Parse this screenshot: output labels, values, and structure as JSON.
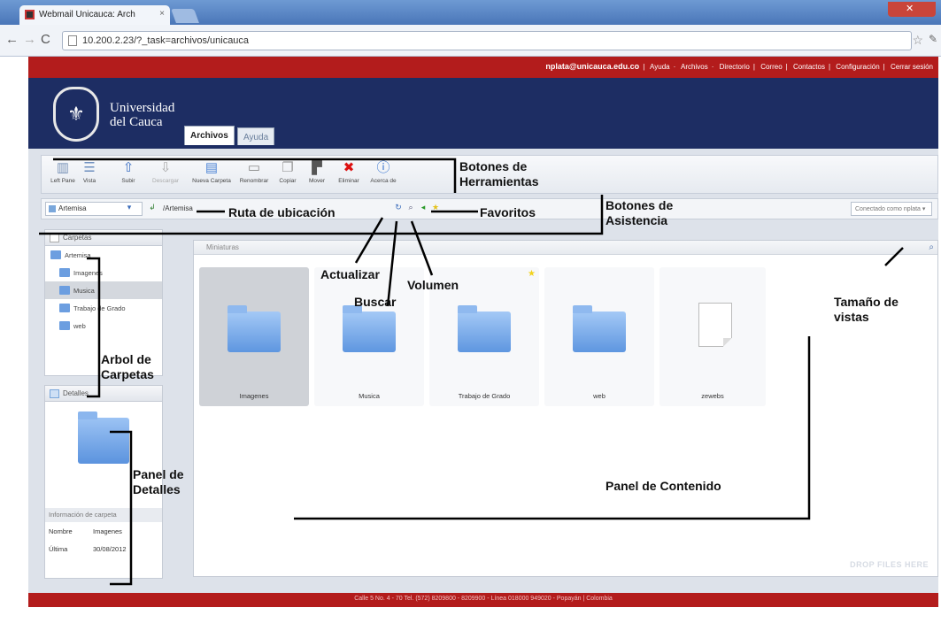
{
  "browser": {
    "tab_title": "Webmail Unicauca: Arch",
    "tab_close": "×",
    "url": "10.200.2.23/?_task=archivos/unicauca",
    "back_icon": "arrow-left",
    "forward_icon": "arrow-right",
    "reload_icon": "reload",
    "window_close": "✕"
  },
  "topbar": {
    "user_email": "nplata@unicauca.edu.co",
    "links": [
      "Ayuda",
      "Archivos",
      "Directorio",
      "Correo",
      "Contactos",
      "Configuración",
      "Cerrar sesión"
    ]
  },
  "header": {
    "university_line1": "Universidad",
    "university_line2": "del Cauca",
    "tabs": [
      "Archivos",
      "Ayuda"
    ]
  },
  "toolbar": {
    "buttons": [
      {
        "label": "Left Pane",
        "icon": "layout-icon"
      },
      {
        "label": "Vista",
        "icon": "view-icon"
      },
      {
        "label": "Subir",
        "icon": "upload-icon"
      },
      {
        "label": "Descargar",
        "icon": "download-icon"
      },
      {
        "label": "Nueva Carpeta",
        "icon": "new-folder-icon"
      },
      {
        "label": "Renombrar",
        "icon": "rename-icon"
      },
      {
        "label": "Copiar",
        "icon": "copy-icon"
      },
      {
        "label": "Mover",
        "icon": "move-icon"
      },
      {
        "label": "Eliminar",
        "icon": "delete-icon"
      },
      {
        "label": "Acerca de",
        "icon": "info-icon"
      }
    ]
  },
  "location": {
    "drive": "Artemisa",
    "path": "/Artemisa",
    "connection": "Conectado como nplata"
  },
  "folders_panel": {
    "title": "Carpetas",
    "items": [
      "Artemisa",
      "Imagenes",
      "Musica",
      "Trabajo de Grado",
      "web"
    ]
  },
  "details_panel": {
    "title": "Detalles",
    "info_title": "Información de carpeta",
    "rows": [
      {
        "label": "Nombre",
        "value": "Imagenes"
      },
      {
        "label": "Última",
        "value": "30/08/2012"
      }
    ]
  },
  "content": {
    "title": "Miniaturas",
    "items": [
      {
        "label": "Imagenes",
        "type": "folder"
      },
      {
        "label": "Musica",
        "type": "folder"
      },
      {
        "label": "Trabajo de Grado",
        "type": "folder"
      },
      {
        "label": "web",
        "type": "folder"
      },
      {
        "label": "zewebs",
        "type": "file"
      }
    ],
    "drop_hint": "DROP FILES HERE"
  },
  "footer": {
    "text": "Calle 5 No. 4 - 70 Tel. (572) 8209800 - 8209900 - Línea 018000 949020 - Popayán | Colombia"
  },
  "annotations": {
    "toolbar": "Botones de\nHerramientas",
    "assist": "Botones de\nAsistencia",
    "path": "Ruta de ubicación",
    "favorites": "Favoritos",
    "refresh": "Actualizar",
    "volume": "Volumen",
    "search": "Buscar",
    "tree": "Arbol de\nCarpetas",
    "details": "Panel de\nDetalles",
    "content": "Panel de Contenido",
    "size": "Tamaño de\nvistas"
  },
  "colors": {
    "accent_red": "#b31c1c",
    "header_navy": "#1d2d63",
    "folder_blue": "#6c9ee0",
    "favorite_yellow": "#f2d21c"
  }
}
